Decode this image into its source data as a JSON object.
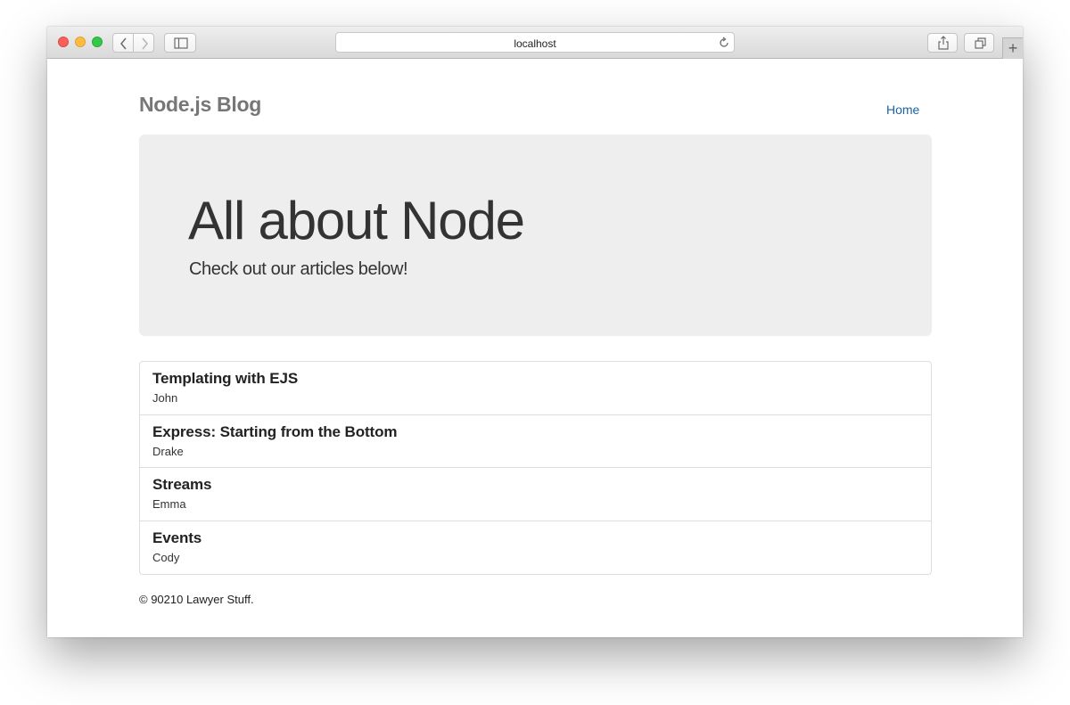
{
  "browser": {
    "url": "localhost",
    "new_tab_label": "+"
  },
  "site": {
    "brand": "Node.js Blog",
    "nav": [
      {
        "label": "Home"
      }
    ]
  },
  "jumbotron": {
    "heading": "All about Node",
    "subheading": "Check out our articles below!"
  },
  "articles": [
    {
      "title": "Templating with EJS",
      "author": "John"
    },
    {
      "title": "Express: Starting from the Bottom",
      "author": "Drake"
    },
    {
      "title": "Streams",
      "author": "Emma"
    },
    {
      "title": "Events",
      "author": "Cody"
    }
  ],
  "footer": {
    "text": "© 90210 Lawyer Stuff."
  },
  "colors": {
    "link": "#1a63a8",
    "brand": "#777777",
    "jumbotron_bg": "#eeeeee",
    "close": "#fc605b",
    "minimize": "#fdbc40",
    "zoom": "#34c84a"
  },
  "icons": {
    "back": "chevron-left-icon",
    "forward": "chevron-right-icon",
    "sidebar": "sidebar-icon",
    "reload": "reload-icon",
    "share": "share-icon",
    "tabs": "tabs-overview-icon"
  }
}
